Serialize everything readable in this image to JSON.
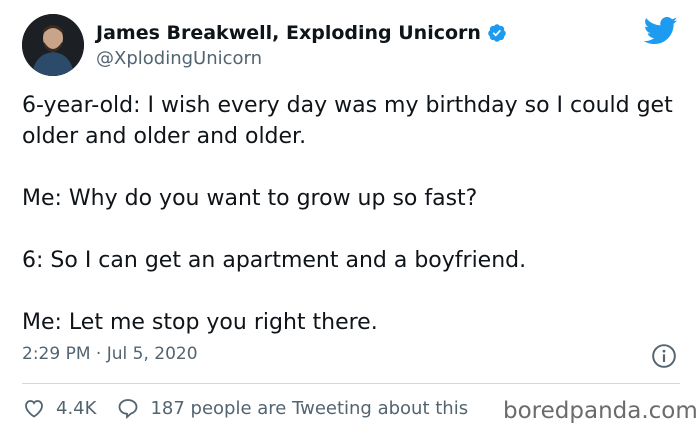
{
  "author": {
    "name": "James Breakwell, Exploding Unicorn",
    "handle": "@XplodingUnicorn",
    "verified": true
  },
  "tweet": {
    "paragraphs": [
      "6-year-old: I wish every day was my birthday so I could get older and older and older.",
      "Me: Why do you want to grow up so fast?",
      "6: So I can get an apartment and a boyfriend.",
      "Me: Let me stop you right there."
    ],
    "timestamp": "2:29 PM · Jul 5, 2020"
  },
  "actions": {
    "likes": "4.4K",
    "tweeting": "187 people are Tweeting about this"
  },
  "watermark": "boredpanda.com",
  "colors": {
    "twitter_blue": "#1d9bf0",
    "text": "#0f1419",
    "secondary": "#536471",
    "divider": "#cfd9de"
  },
  "icons": [
    "verified-badge-icon",
    "twitter-bird-icon",
    "info-icon",
    "heart-icon",
    "comment-bubble-icon"
  ]
}
